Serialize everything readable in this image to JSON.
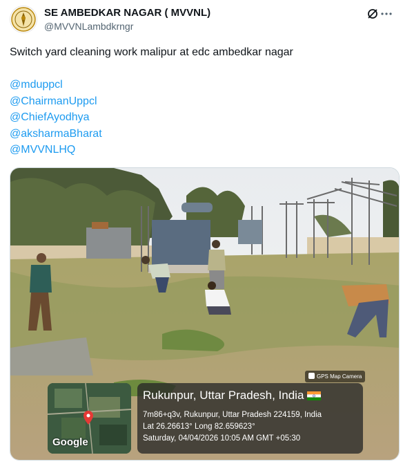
{
  "account": {
    "display_name": "SE AMBEDKAR NAGAR ( MVVNL)",
    "handle": "@MVVNLambdkrngr"
  },
  "tweet": {
    "text": "Switch yard  cleaning work malipur at edc ambedkar nagar",
    "mentions": [
      "@mduppcl",
      "@ChairmanUppcl",
      "@ChiefAyodhya",
      "@aksharmaBharat",
      "@MVVNLHQ"
    ]
  },
  "photo_overlay": {
    "camera_tag": "GPS Map Camera",
    "map_logo": "Google",
    "location_title": "Rukunpur, Uttar Pradesh, India",
    "address": "7m86+q3v, Rukunpur, Uttar Pradesh 224159, India",
    "coordinates": "Lat 26.26613° Long 82.659623°",
    "timestamp": "Saturday, 04/04/2026 10:05 AM GMT +05:30"
  },
  "icons": {
    "avatar": "emblem-avatar-icon",
    "grok": "grok-icon",
    "more": "more-options-icon",
    "pin": "map-pin-icon",
    "flag": "india-flag-icon"
  },
  "colors": {
    "mention": "#1d9bf0",
    "handle": "#536471",
    "text": "#0f1419"
  }
}
